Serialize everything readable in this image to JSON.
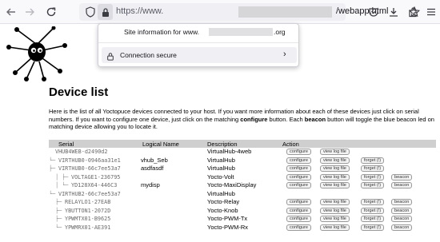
{
  "browser": {
    "url_prefix": "https://www.",
    "url_path": "/webapp.html"
  },
  "site_info": {
    "title_prefix": "Site information for www.",
    "title_suffix": ".org",
    "connection_label": "Connection secure"
  },
  "page": {
    "title": "Device list",
    "intro_part1": "Here is the list of all Yoctopuce devices connected to your host. If you want more information about each of these devices just click on serial numbers. If you want to configure one device, just click on the matching ",
    "intro_bold1": "configure",
    "intro_part2": " button. Each ",
    "intro_bold2": "beacon",
    "intro_part3": " button will toggle the blue beacon led on matching device allowing you to locate it."
  },
  "table": {
    "headers": {
      "serial": "Serial",
      "logical_name": "Logical Name",
      "description": "Description",
      "action": "Action"
    },
    "button_labels": {
      "configure": "configure",
      "view_log": "view log file",
      "forget": "forget (!)",
      "beacon": "beacon"
    },
    "rows": [
      {
        "prefix": "",
        "serial": "VHUB4WEB-d2490d2",
        "logical_name": "",
        "description": "VirtualHub-4web",
        "configure": "configure",
        "log": "view log file",
        "forget": "",
        "beacon": ""
      },
      {
        "prefix": "└─",
        "serial": "VIRTHUB0-0946aa31e1",
        "logical_name": "vhub_Seb",
        "description": "VirtualHub",
        "configure": "configure",
        "log": "view log file",
        "forget": "forget (!)",
        "beacon": ""
      },
      {
        "prefix": "├─",
        "serial": "VIRTHUB0-66c7ee53a7",
        "logical_name": "asdfasdf",
        "description": "VirtualHub",
        "configure": "configure",
        "log": "view log file",
        "forget": "forget (!)",
        "beacon": ""
      },
      {
        "prefix": "│ ├─",
        "serial": "VOLTAGE1-236795",
        "logical_name": "",
        "description": "Yocto-Volt",
        "configure": "configure",
        "log": "view log file",
        "forget": "forget (!)",
        "beacon": "beacon"
      },
      {
        "prefix": "│ └─",
        "serial": "YD128X64-446C3",
        "logical_name": "mydisp",
        "description": "Yocto-MaxiDisplay",
        "configure": "configure",
        "log": "view log file",
        "forget": "forget (!)",
        "beacon": "beacon"
      },
      {
        "prefix": "└─",
        "serial": "VIRTHUB2-66c7ee53a7",
        "logical_name": "",
        "description": "VirtualHub",
        "configure": "",
        "log": "",
        "forget": "",
        "beacon": ""
      },
      {
        "prefix": "├─",
        "serial": "RELAYLO1-27EAB",
        "logical_name": "",
        "description": "Yocto-Relay",
        "configure": "configure",
        "log": "view log file",
        "forget": "forget (!)",
        "beacon": "beacon"
      },
      {
        "prefix": "├─",
        "serial": "YBUTTON1-2072D",
        "logical_name": "",
        "description": "Yocto-Knob",
        "configure": "configure",
        "log": "view log file",
        "forget": "forget (!)",
        "beacon": "beacon"
      },
      {
        "prefix": "├─",
        "serial": "YPWMTX01-B9625",
        "logical_name": "",
        "description": "Yocto-PWM-Tx",
        "configure": "configure",
        "log": "view log file",
        "forget": "forget (!)",
        "beacon": "beacon"
      },
      {
        "prefix": "└─",
        "serial": "YPWMRX01-AE391",
        "logical_name": "",
        "description": "Yocto-PWM-Rx",
        "configure": "configure",
        "log": "view log file",
        "forget": "forget (!)",
        "beacon": "beacon"
      }
    ]
  }
}
